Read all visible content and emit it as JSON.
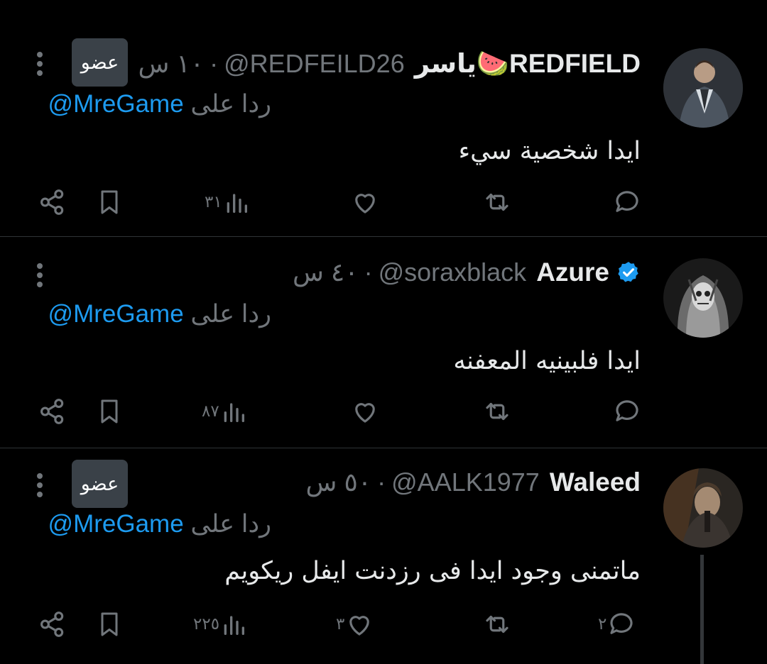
{
  "tweets": [
    {
      "name": "ياسر🍉REDFIELD",
      "handle": "@REDFEILD26",
      "time": "١٠ س",
      "badge": "عضو",
      "reply_label": "ردا على",
      "reply_mention": "@MreGame",
      "text": "ايدا شخصية سيء",
      "stats": {
        "replies": "",
        "retweets": "",
        "likes": "",
        "views": "٣١"
      },
      "verified": false
    },
    {
      "name": "Azure",
      "handle": "@soraxblack",
      "time": "٤٠ س",
      "badge": "",
      "reply_label": "ردا على",
      "reply_mention": "@MreGame",
      "text": "ايدا فلبينيه المعفنه",
      "stats": {
        "replies": "",
        "retweets": "",
        "likes": "",
        "views": "٨٧"
      },
      "verified": true
    },
    {
      "name": "Waleed",
      "handle": "@AALK1977",
      "time": "٥٠ س",
      "badge": "عضو",
      "reply_label": "ردا على",
      "reply_mention": "@MreGame",
      "text": "ماتمنى وجود ايدا فى رزدنت ايفل ريكويم",
      "stats": {
        "replies": "٢",
        "retweets": "",
        "likes": "٣",
        "views": "٢٢٥"
      },
      "verified": false
    }
  ],
  "colors": {
    "background": "#000000",
    "text": "#e7e9ea",
    "muted": "#71767b",
    "accent": "#1d9bf0",
    "divider": "#2f3336",
    "badge_bg": "#3a4148"
  },
  "icons": {
    "reply": "reply-icon",
    "retweet": "retweet-icon",
    "like": "heart-icon",
    "views": "views-icon",
    "bookmark": "bookmark-icon",
    "share": "share-icon",
    "more": "more-icon",
    "verified": "verified-badge-icon"
  }
}
